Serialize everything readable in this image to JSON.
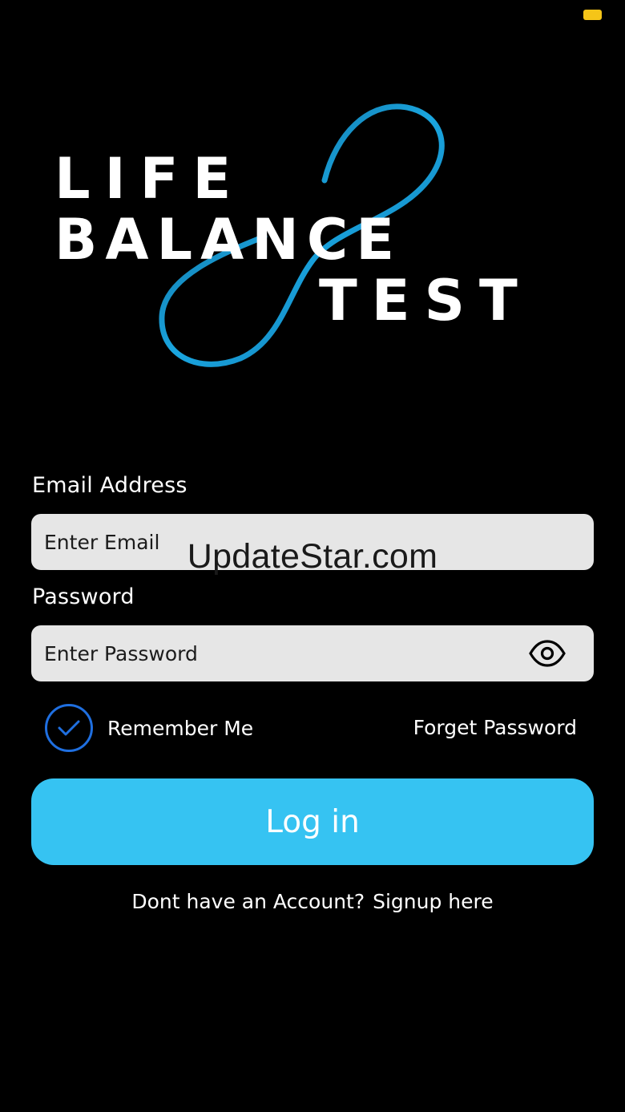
{
  "colors": {
    "background": "#000000",
    "accent": "#36c3f2",
    "checkbox": "#1f6fe0",
    "field_bg": "#e6e6e6",
    "logo_loop": "#1aa6e0"
  },
  "logo": {
    "line1": "LIFE",
    "line2": "BALANCE",
    "line3": "TEST"
  },
  "email": {
    "label": "Email Address",
    "placeholder": "Enter Email"
  },
  "password": {
    "label": "Password",
    "placeholder": "Enter Password",
    "toggle_icon": "eye-icon"
  },
  "watermark": "UpdateStar.com",
  "remember": {
    "label": "Remember Me",
    "checked": true,
    "icon": "check-icon"
  },
  "forgot_label": "Forget Password",
  "login_label": "Log in",
  "signup": {
    "prompt": "Dont have an Account?",
    "link": "Signup here"
  }
}
